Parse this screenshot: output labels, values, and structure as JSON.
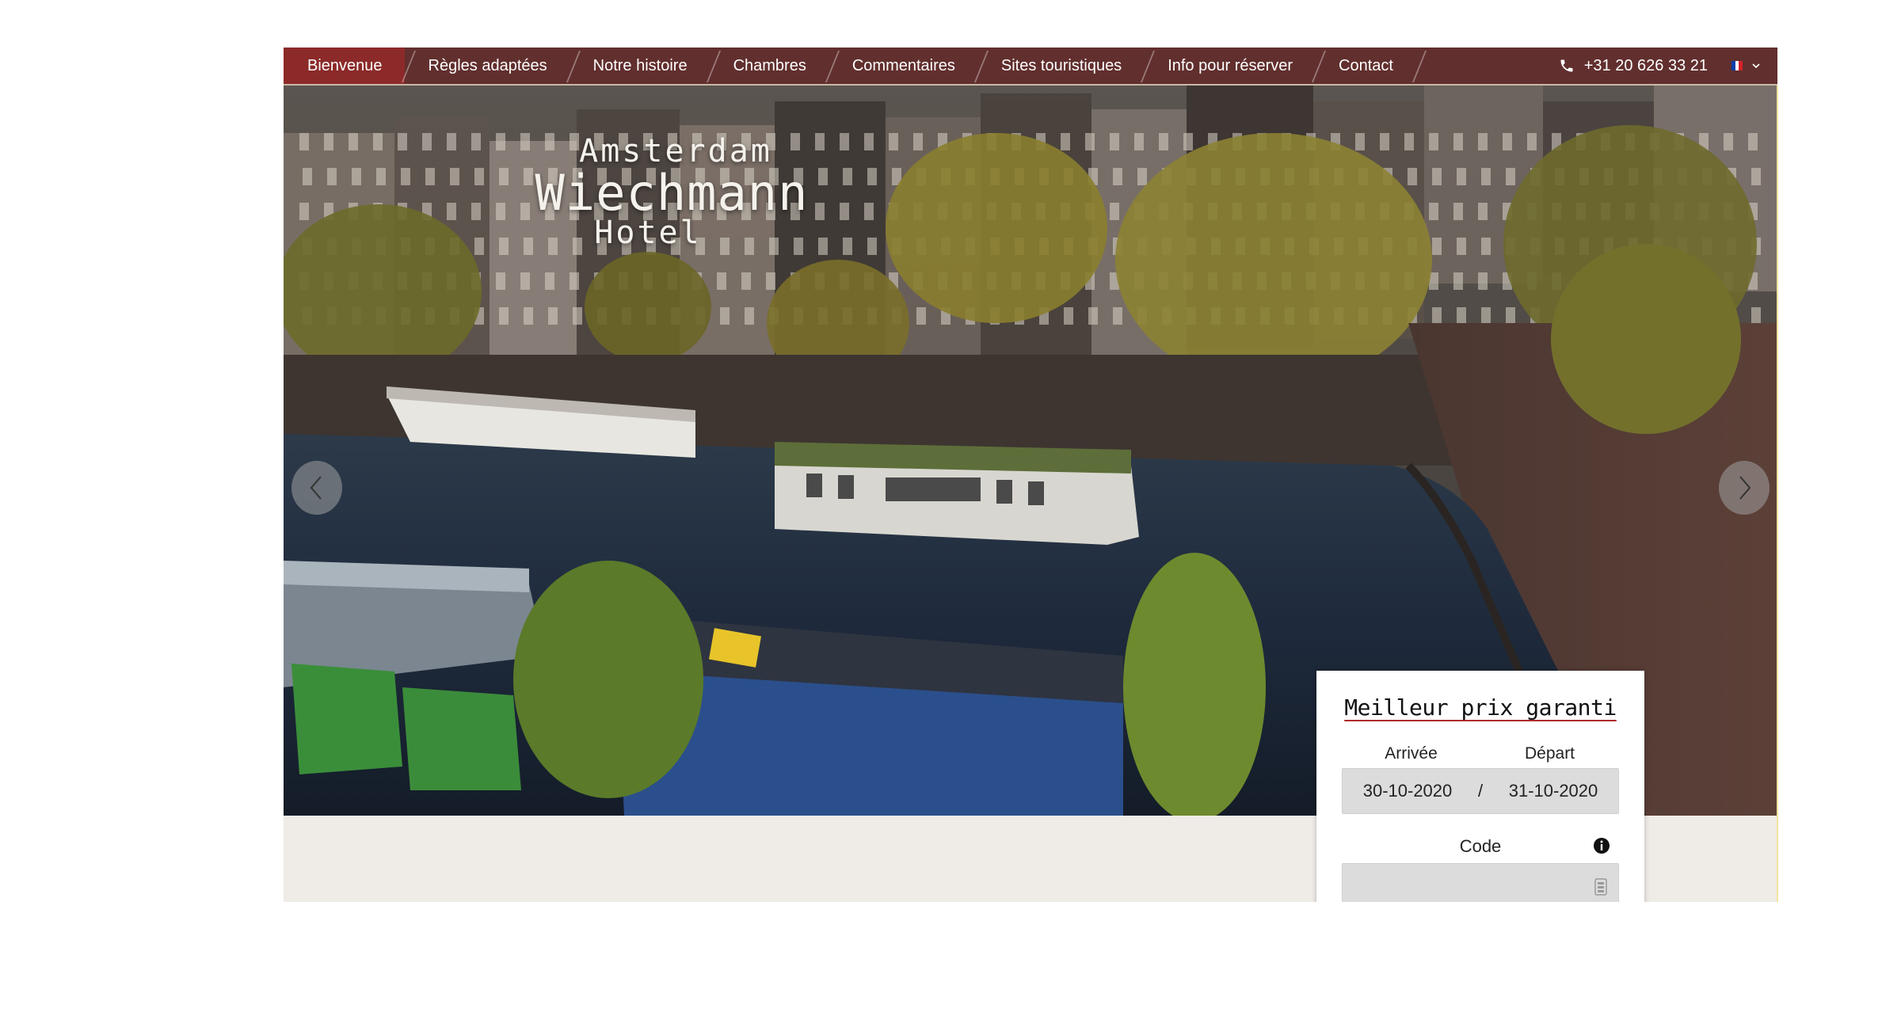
{
  "nav": {
    "items": [
      {
        "label": "Bienvenue",
        "active": true
      },
      {
        "label": "Règles adaptées",
        "active": false
      },
      {
        "label": "Notre histoire",
        "active": false
      },
      {
        "label": "Chambres",
        "active": false
      },
      {
        "label": "Commentaires",
        "active": false
      },
      {
        "label": "Sites touristiques",
        "active": false
      },
      {
        "label": "Info pour réserver",
        "active": false
      },
      {
        "label": "Contact",
        "active": false
      }
    ],
    "phone": "+31 20 626 33 21",
    "language_icon": "french-flag-icon",
    "colors": {
      "bar": "#612f2e",
      "active": "#8b2a29"
    }
  },
  "logo": {
    "line1": "Amsterdam",
    "line2": "Wiechmann",
    "line3": "Hotel"
  },
  "slider": {
    "prev_icon": "chevron-left-icon",
    "next_icon": "chevron-right-icon"
  },
  "booking": {
    "title": "Meilleur prix garanti",
    "arrival_label": "Arrivée",
    "departure_label": "Départ",
    "arrival_date": "30-10-2020",
    "separator": "/",
    "departure_date": "31-10-2020",
    "code_label": "Code",
    "code_value": ""
  }
}
